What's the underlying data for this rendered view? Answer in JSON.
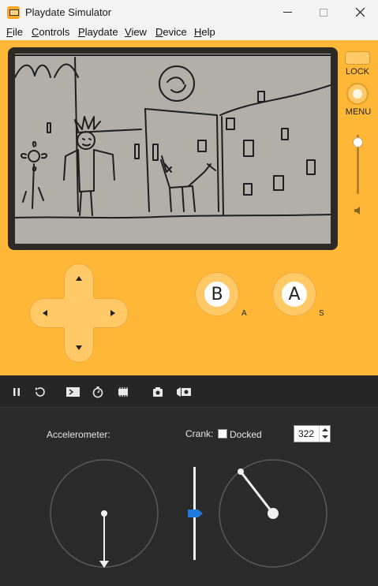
{
  "window": {
    "title": "Playdate Simulator",
    "minimize_glyph": "—",
    "maximize_glyph": "☐",
    "close_glyph": "✕"
  },
  "menubar": {
    "items": [
      {
        "label": "File"
      },
      {
        "label": "Controls"
      },
      {
        "label": "Playdate"
      },
      {
        "label": "View"
      },
      {
        "label": "Device"
      },
      {
        "label": "Help"
      }
    ]
  },
  "device": {
    "lock_label": "LOCK",
    "menu_label": "MENU",
    "volume_level": 0.88,
    "button_b": "B",
    "button_a": "A",
    "button_b_key": "A",
    "button_a_key": "S",
    "body_color": "#ffb738",
    "screen_color": "#b1afa8"
  },
  "toolbar": {
    "icons": [
      "pause-icon",
      "restart-icon",
      "console-icon",
      "stopwatch-icon",
      "device-memory-icon",
      "screenshot-icon",
      "record-video-icon"
    ]
  },
  "panel": {
    "accelerometer_label": "Accelerometer:",
    "crank_label": "Crank:",
    "docked_label": "Docked",
    "docked_checked": false,
    "crank_angle": "322"
  }
}
